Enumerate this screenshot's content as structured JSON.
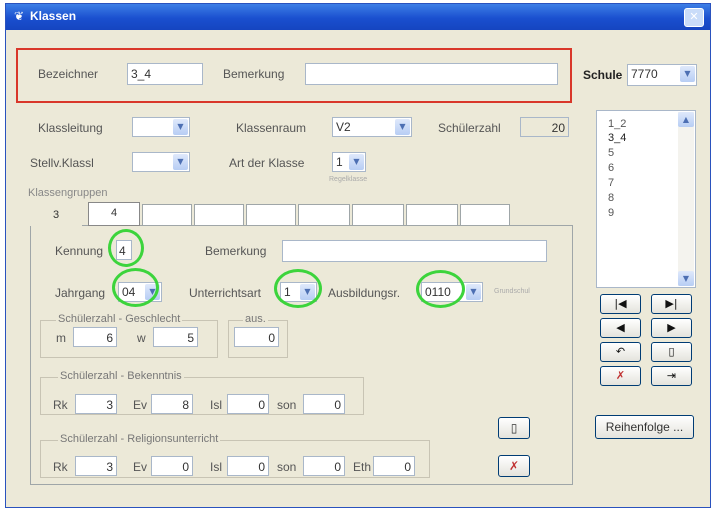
{
  "window": {
    "title": "Klassen",
    "title_icon": "app-icon",
    "close_label": "✕"
  },
  "header": {
    "bezeichner_label": "Bezeichner",
    "bezeichner_value": "3_4",
    "bemerkung_label": "Bemerkung",
    "bemerkung_value": "",
    "schule_label": "Schule",
    "schule_value": "7770"
  },
  "details": {
    "klassleitung_label": "Klassleitung",
    "klassleitung_value": "",
    "klassenraum_label": "Klassenraum",
    "klassenraum_value": "V2",
    "schuelerzahl_label": "Schülerzahl",
    "schuelerzahl_value": "20",
    "stellv_label": "Stellv.Klassl",
    "stellv_value": "",
    "art_label": "Art der Klasse",
    "art_value": "1",
    "art_hint": "Regelklasse"
  },
  "klassengruppen": {
    "label": "Klassengruppen",
    "tabs": [
      "3",
      "4",
      "",
      "",
      "",
      "",
      "",
      "",
      ""
    ],
    "active_tab": 1
  },
  "group": {
    "kennung_label": "Kennung",
    "kennung_value": "4",
    "bemerkung_label": "Bemerkung",
    "bemerkung_value": "",
    "jahrgang_label": "Jahrgang",
    "jahrgang_value": "04",
    "unterrichtsart_label": "Unterrichtsart",
    "unterrichtsart_value": "1",
    "ausbildungsr_label": "Ausbildungsr.",
    "ausbildungsr_value": "0110",
    "ausbildungsr_hint": "Grundschul"
  },
  "geschlecht": {
    "title": "Schülerzahl - Geschlecht",
    "m_label": "m",
    "m_value": "6",
    "w_label": "w",
    "w_value": "5"
  },
  "aus": {
    "title": "aus.",
    "value": "0"
  },
  "bekenntnis": {
    "title": "Schülerzahl - Bekenntnis",
    "rk_label": "Rk",
    "rk_value": "3",
    "ev_label": "Ev",
    "ev_value": "8",
    "isl_label": "Isl",
    "isl_value": "0",
    "son_label": "son",
    "son_value": "0"
  },
  "religion": {
    "title": "Schülerzahl - Religionsunterricht",
    "rk_label": "Rk",
    "rk_value": "3",
    "ev_label": "Ev",
    "ev_value": "0",
    "isl_label": "Isl",
    "isl_value": "0",
    "son_label": "son",
    "son_value": "0",
    "eth_label": "Eth",
    "eth_value": "0"
  },
  "class_list": {
    "items": [
      "1_2",
      "3_4",
      "5",
      "6",
      "7",
      "8",
      "9"
    ],
    "selected": 1
  },
  "nav": {
    "first": "|◀",
    "last": "▶|",
    "prev": "◀",
    "next": "▶",
    "undo": "↶",
    "new": "▯",
    "delete": "✗",
    "export": "⇥"
  },
  "reihenfolge_label": "Reihenfolge ...",
  "colors": {
    "title_bar": "#1a4fcf",
    "highlight_ring": "#3cd43c",
    "red_frame": "#d9372a",
    "dialog_bg": "#ece9d8"
  }
}
